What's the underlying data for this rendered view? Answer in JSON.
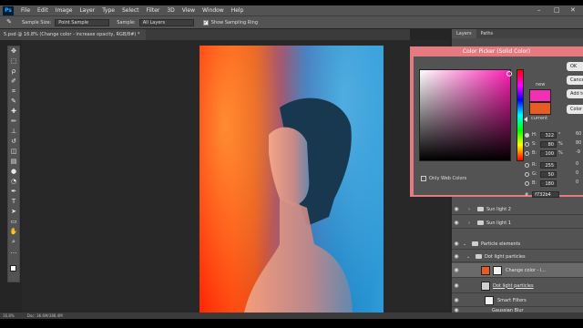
{
  "menubar": {
    "logo": "Ps",
    "items": [
      "File",
      "Edit",
      "Image",
      "Layer",
      "Type",
      "Select",
      "Filter",
      "3D",
      "View",
      "Window",
      "Help"
    ]
  },
  "options": {
    "sample_size_label": "Sample Size:",
    "sample_size_value": "Point Sample",
    "sample_label": "Sample:",
    "sample_value": "All Layers",
    "show_ring_label": "Show Sampling Ring"
  },
  "document": {
    "tab_title": "5.psd @ 16.8% (Change color - increase opacity, RGB/8#) *"
  },
  "status": {
    "zoom": "16.8%",
    "doc_info": "Doc: 36.6M/388.4M"
  },
  "panels": {
    "tabs": [
      "Layers",
      "Paths"
    ]
  },
  "layers": [
    {
      "name": "Sun light 2",
      "type": "folder",
      "indent": 1
    },
    {
      "name": "Sun light 1",
      "type": "folder",
      "indent": 1
    },
    {
      "name": "Particle elements",
      "type": "folder",
      "indent": 0
    },
    {
      "name": "Dot light particles",
      "type": "folder",
      "indent": 1
    },
    {
      "name": "Change color - i...",
      "type": "adjustment",
      "indent": 2,
      "selected": true
    },
    {
      "name": "Dot light particles",
      "type": "smart",
      "indent": 2
    },
    {
      "name": "Smart Filters",
      "type": "filters",
      "indent": 3
    },
    {
      "name": "Gaussian Blur",
      "type": "filter",
      "indent": 3
    }
  ],
  "picker": {
    "title": "Color Picker (Solid Color)",
    "new_label": "new",
    "current_label": "current",
    "ok": "OK",
    "cancel": "Cancel",
    "add_swatches": "Add to Swatches",
    "libraries": "Color Libraries",
    "only_web": "Only Web Colors",
    "fields": [
      {
        "name": "H:",
        "value": "322",
        "unit": "°",
        "on": true
      },
      {
        "name": "S:",
        "value": "80",
        "unit": "%",
        "on": false
      },
      {
        "name": "B:",
        "value": "100",
        "unit": "%",
        "on": false
      },
      {
        "name": "R:",
        "value": "255",
        "unit": "",
        "on": false
      },
      {
        "name": "G:",
        "value": "50",
        "unit": "",
        "on": false
      },
      {
        "name": "B:",
        "value": "180",
        "unit": "",
        "on": false
      }
    ],
    "right_values": [
      "60",
      "80",
      "-9",
      "0",
      "0",
      "0"
    ],
    "hex": "f732b4",
    "hex_label": "#",
    "new_color": "#f32fb4",
    "current_color": "#e85b22"
  },
  "colors": {
    "accent_dialog_border": "#e57b81",
    "panel": "#535353"
  },
  "tools": [
    "move-icon",
    "marquee-icon",
    "lasso-icon",
    "quick-select-icon",
    "crop-icon",
    "eyedropper-icon",
    "healing-icon",
    "brush-icon",
    "stamp-icon",
    "history-brush-icon",
    "eraser-icon",
    "gradient-icon",
    "blur-icon",
    "dodge-icon",
    "pen-icon",
    "type-icon",
    "path-select-icon",
    "rectangle-icon",
    "hand-icon",
    "zoom-icon",
    "more-icon"
  ]
}
